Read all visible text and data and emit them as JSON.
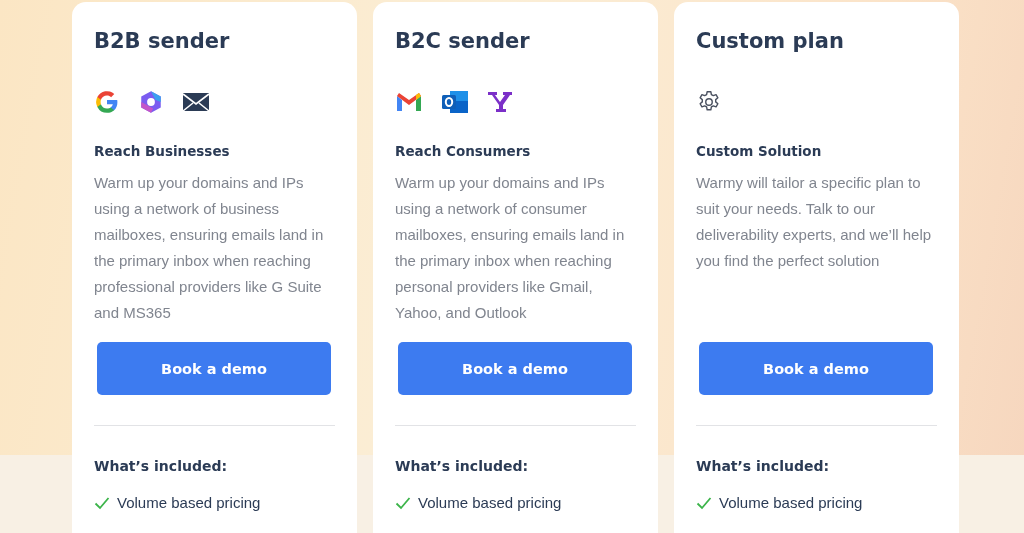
{
  "plans": [
    {
      "title": "B2B sender",
      "icons": [
        {
          "kind": "google"
        },
        {
          "kind": "hexagon"
        },
        {
          "kind": "envelope"
        }
      ],
      "subtitle": "Reach Businesses",
      "description": "Warm up your domains and IPs using a network of business mailboxes, ensuring emails land in the primary inbox when reaching professional providers like G Suite and MS365",
      "button": "Book a demo",
      "included_heading": "What’s included:",
      "features": [
        "Volume based pricing"
      ]
    },
    {
      "title": "B2C sender",
      "icons": [
        {
          "kind": "gmail"
        },
        {
          "kind": "outlook"
        },
        {
          "kind": "yahoo"
        }
      ],
      "subtitle": "Reach Consumers",
      "description": "Warm up your domains and IPs using a network of consumer mailboxes, ensuring emails land in the primary inbox when reaching personal providers like Gmail, Yahoo, and Outlook",
      "button": "Book a demo",
      "included_heading": "What’s included:",
      "features": [
        "Volume based pricing"
      ]
    },
    {
      "title": "Custom plan",
      "icons": [
        {
          "kind": "gear"
        }
      ],
      "subtitle": "Custom Solution",
      "description": "Warmy will tailor a specific plan to suit your needs. Talk to our deliverability experts, and we’ll help you find the perfect solution",
      "button": "Book a demo",
      "included_heading": "What’s included:",
      "features": [
        "Volume based pricing"
      ]
    }
  ]
}
